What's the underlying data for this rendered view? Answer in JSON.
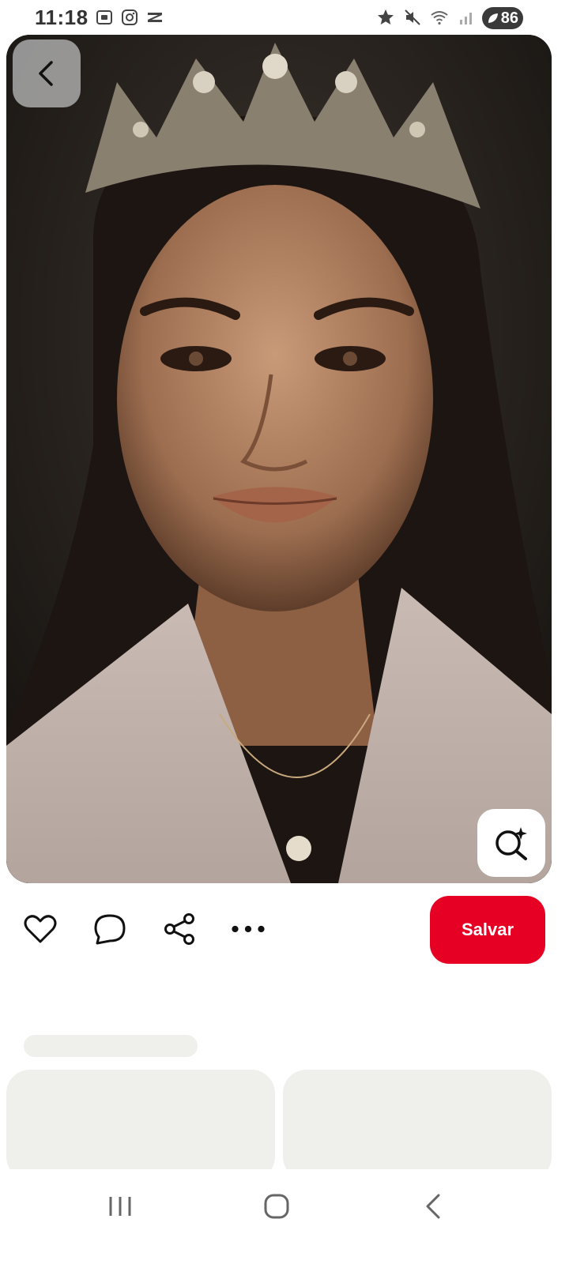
{
  "status_bar": {
    "time": "11:18",
    "battery_level": "86",
    "left_icons": [
      "screenshot-icon",
      "instagram-icon",
      "capcut-icon"
    ],
    "right_icons": [
      "star-icon",
      "mute-icon",
      "wifi-icon",
      "signal-icon",
      "battery-icon"
    ]
  },
  "pin": {
    "image_subject": "portrait-with-crown",
    "back_icon": "chevron-left-icon",
    "lens_icon": "visual-search-icon"
  },
  "actions": {
    "icons": [
      "heart-icon",
      "comment-icon",
      "share-icon",
      "more-icon"
    ],
    "save_label": "Salvar",
    "save_color": "#e60023"
  },
  "nav_bar": {
    "icons": [
      "recent-apps-icon",
      "home-icon",
      "back-icon"
    ]
  }
}
